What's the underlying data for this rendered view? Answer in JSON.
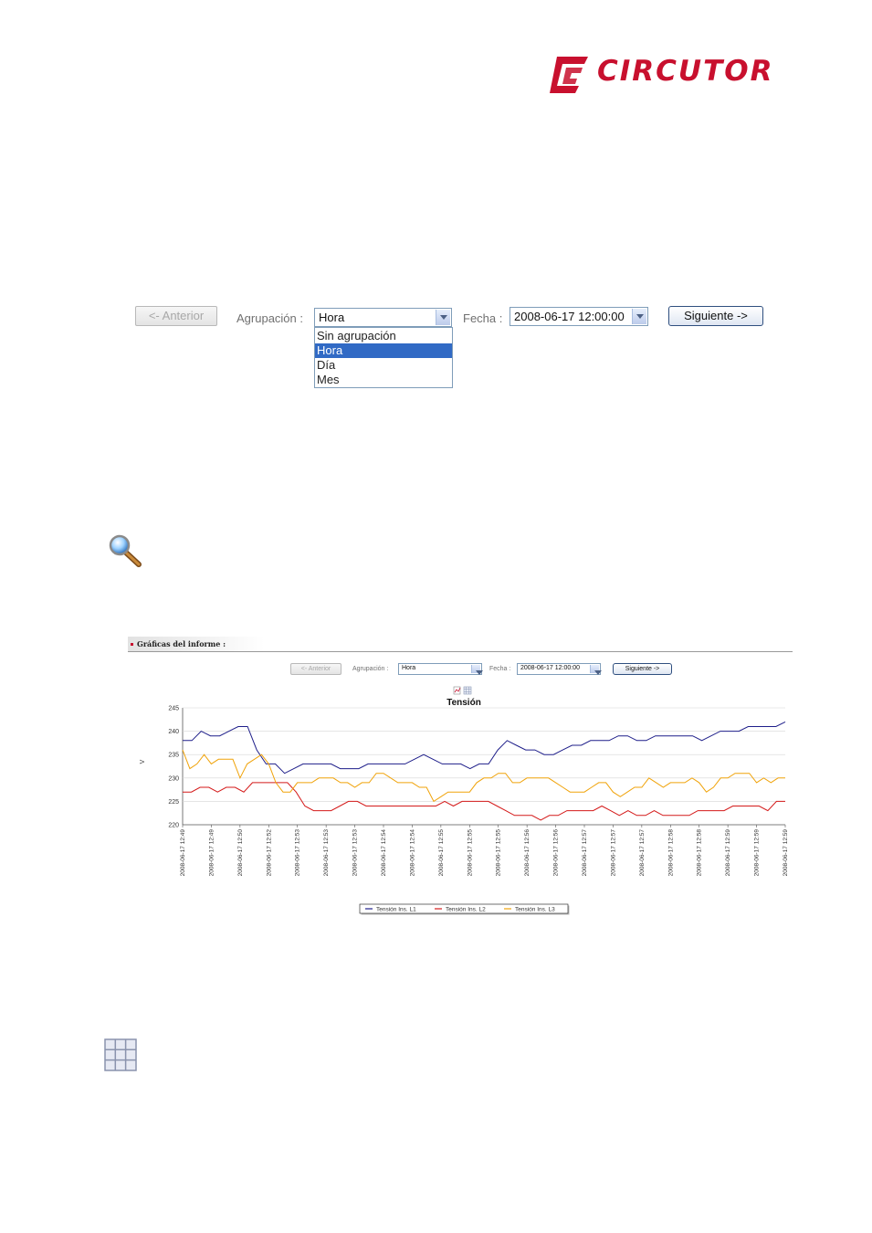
{
  "brand": {
    "name": "CIRCUTOR",
    "color": "#c8102e"
  },
  "toolbar": {
    "prev_label": "<- Anterior",
    "group_label": "Agrupación :",
    "group_value": "Hora",
    "group_options": [
      "Sin agrupación",
      "Hora",
      "Día",
      "Mes"
    ],
    "group_selected_index": 1,
    "date_label": "Fecha :",
    "date_value": "2008-06-17 12:00:00",
    "next_label": "Siguiente ->"
  },
  "icons": {
    "zoom": "magnifier-icon",
    "table": "grid-table-icon"
  },
  "report": {
    "header": "Gráficas del informe :",
    "toolbar": {
      "prev_label": "<- Anterior",
      "group_label": "Agrupación :",
      "group_value": "Hora",
      "date_label": "Fecha :",
      "date_value": "2008-06-17 12:00:00",
      "next_label": "Siguiente ->"
    }
  },
  "chart_data": {
    "type": "line",
    "title": "Tensión",
    "ylabel": "V",
    "xlabel": "",
    "ylim": [
      220,
      245
    ],
    "yticks": [
      220,
      225,
      230,
      235,
      240,
      245
    ],
    "grid": true,
    "legend_position": "bottom",
    "x_tick_labels": [
      "2008-06-17 12:49",
      "2008-06-17 12:49",
      "2008-06-17 12:50",
      "2008-06-17 12:52",
      "2008-06-17 12:53",
      "2008-06-17 12:53",
      "2008-06-17 12:53",
      "2008-06-17 12:54",
      "2008-06-17 12:54",
      "2008-06-17 12:55",
      "2008-06-17 12:55",
      "2008-06-17 12:55",
      "2008-06-17 12:56",
      "2008-06-17 12:56",
      "2008-06-17 12:57",
      "2008-06-17 12:57",
      "2008-06-17 12:57",
      "2008-06-17 12:58",
      "2008-06-17 12:58",
      "2008-06-17 12:59",
      "2008-06-17 12:59",
      "2008-06-17 12:59"
    ],
    "series": [
      {
        "name": "Tensión Ins. L1",
        "color": "#1f1f8a",
        "values": [
          238,
          238,
          240,
          239,
          239,
          240,
          241,
          241,
          236,
          233,
          233,
          231,
          232,
          233,
          233,
          233,
          233,
          232,
          232,
          232,
          233,
          233,
          233,
          233,
          233,
          234,
          235,
          234,
          233,
          233,
          233,
          232,
          233,
          233,
          236,
          238,
          237,
          236,
          236,
          235,
          235,
          236,
          237,
          237,
          238,
          238,
          238,
          239,
          239,
          238,
          238,
          239,
          239,
          239,
          239,
          239,
          238,
          239,
          240,
          240,
          240,
          241,
          241,
          241,
          241,
          242
        ]
      },
      {
        "name": "Tensión Ins. L2",
        "color": "#d41a1a",
        "values": [
          227,
          227,
          228,
          228,
          227,
          228,
          228,
          227,
          229,
          229,
          229,
          229,
          229,
          227,
          224,
          223,
          223,
          223,
          224,
          225,
          225,
          224,
          224,
          224,
          224,
          224,
          224,
          224,
          224,
          224,
          225,
          224,
          225,
          225,
          225,
          225,
          224,
          223,
          222,
          222,
          222,
          221,
          222,
          222,
          223,
          223,
          223,
          223,
          224,
          223,
          222,
          223,
          222,
          222,
          223,
          222,
          222,
          222,
          222,
          223,
          223,
          223,
          223,
          224,
          224,
          224,
          224,
          223,
          225,
          225
        ]
      },
      {
        "name": "Tensión Ins. L3",
        "color": "#f0a30a",
        "values": [
          236,
          232,
          233,
          235,
          233,
          234,
          234,
          234,
          230,
          233,
          234,
          235,
          233,
          229,
          227,
          227,
          229,
          229,
          229,
          230,
          230,
          230,
          229,
          229,
          228,
          229,
          229,
          231,
          231,
          230,
          229,
          229,
          229,
          228,
          228,
          225,
          226,
          227,
          227,
          227,
          227,
          229,
          230,
          230,
          231,
          231,
          229,
          229,
          230,
          230,
          230,
          230,
          229,
          228,
          227,
          227,
          227,
          228,
          229,
          229,
          227,
          226,
          227,
          228,
          228,
          230,
          229,
          228,
          229,
          229,
          229,
          230,
          229,
          227,
          228,
          230,
          230,
          231,
          231,
          231,
          229,
          230,
          229,
          230,
          230
        ]
      }
    ]
  }
}
